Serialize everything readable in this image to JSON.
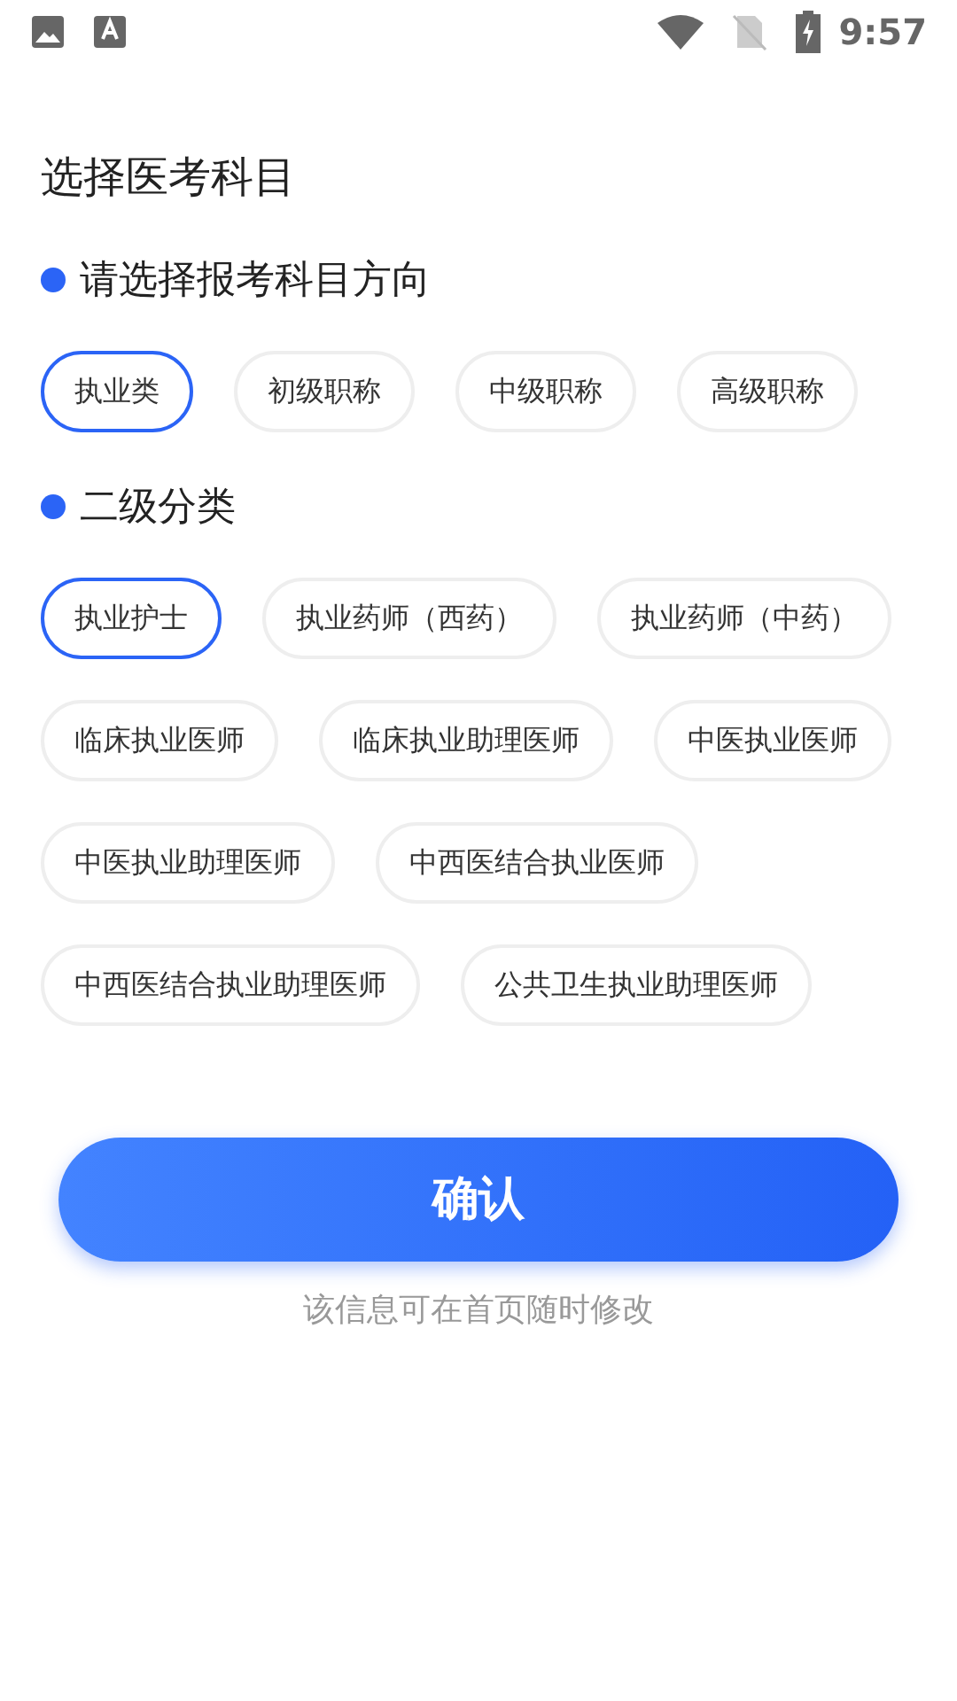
{
  "status_bar": {
    "time": "9:57"
  },
  "title": "选择医考科目",
  "sections": [
    {
      "heading": "请选择报考科目方向",
      "options": [
        {
          "label": "执业类",
          "selected": true
        },
        {
          "label": "初级职称",
          "selected": false
        },
        {
          "label": "中级职称",
          "selected": false
        },
        {
          "label": "高级职称",
          "selected": false
        }
      ]
    },
    {
      "heading": "二级分类",
      "options": [
        {
          "label": "执业护士",
          "selected": true
        },
        {
          "label": "执业药师（西药）",
          "selected": false
        },
        {
          "label": "执业药师（中药）",
          "selected": false
        },
        {
          "label": "临床执业医师",
          "selected": false
        },
        {
          "label": "临床执业助理医师",
          "selected": false
        },
        {
          "label": "中医执业医师",
          "selected": false
        },
        {
          "label": "中医执业助理医师",
          "selected": false
        },
        {
          "label": "中西医结合执业医师",
          "selected": false
        },
        {
          "label": "中西医结合执业助理医师",
          "selected": false
        },
        {
          "label": "公共卫生执业助理医师",
          "selected": false
        }
      ]
    }
  ],
  "confirm_button": "确认",
  "hint": "该信息可在首页随时修改"
}
